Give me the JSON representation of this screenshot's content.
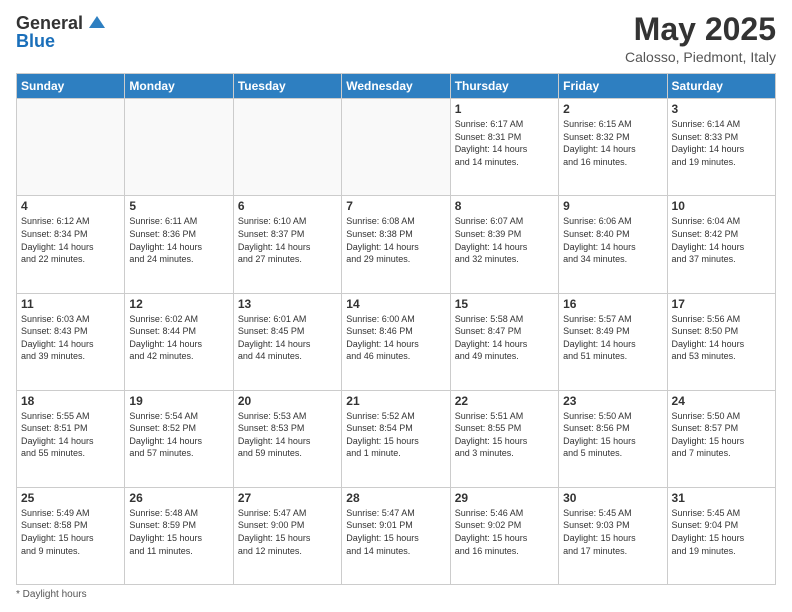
{
  "header": {
    "logo_general": "General",
    "logo_blue": "Blue",
    "month_title": "May 2025",
    "subtitle": "Calosso, Piedmont, Italy"
  },
  "weekdays": [
    "Sunday",
    "Monday",
    "Tuesday",
    "Wednesday",
    "Thursday",
    "Friday",
    "Saturday"
  ],
  "weeks": [
    [
      {
        "day": "",
        "info": ""
      },
      {
        "day": "",
        "info": ""
      },
      {
        "day": "",
        "info": ""
      },
      {
        "day": "",
        "info": ""
      },
      {
        "day": "1",
        "info": "Sunrise: 6:17 AM\nSunset: 8:31 PM\nDaylight: 14 hours\nand 14 minutes."
      },
      {
        "day": "2",
        "info": "Sunrise: 6:15 AM\nSunset: 8:32 PM\nDaylight: 14 hours\nand 16 minutes."
      },
      {
        "day": "3",
        "info": "Sunrise: 6:14 AM\nSunset: 8:33 PM\nDaylight: 14 hours\nand 19 minutes."
      }
    ],
    [
      {
        "day": "4",
        "info": "Sunrise: 6:12 AM\nSunset: 8:34 PM\nDaylight: 14 hours\nand 22 minutes."
      },
      {
        "day": "5",
        "info": "Sunrise: 6:11 AM\nSunset: 8:36 PM\nDaylight: 14 hours\nand 24 minutes."
      },
      {
        "day": "6",
        "info": "Sunrise: 6:10 AM\nSunset: 8:37 PM\nDaylight: 14 hours\nand 27 minutes."
      },
      {
        "day": "7",
        "info": "Sunrise: 6:08 AM\nSunset: 8:38 PM\nDaylight: 14 hours\nand 29 minutes."
      },
      {
        "day": "8",
        "info": "Sunrise: 6:07 AM\nSunset: 8:39 PM\nDaylight: 14 hours\nand 32 minutes."
      },
      {
        "day": "9",
        "info": "Sunrise: 6:06 AM\nSunset: 8:40 PM\nDaylight: 14 hours\nand 34 minutes."
      },
      {
        "day": "10",
        "info": "Sunrise: 6:04 AM\nSunset: 8:42 PM\nDaylight: 14 hours\nand 37 minutes."
      }
    ],
    [
      {
        "day": "11",
        "info": "Sunrise: 6:03 AM\nSunset: 8:43 PM\nDaylight: 14 hours\nand 39 minutes."
      },
      {
        "day": "12",
        "info": "Sunrise: 6:02 AM\nSunset: 8:44 PM\nDaylight: 14 hours\nand 42 minutes."
      },
      {
        "day": "13",
        "info": "Sunrise: 6:01 AM\nSunset: 8:45 PM\nDaylight: 14 hours\nand 44 minutes."
      },
      {
        "day": "14",
        "info": "Sunrise: 6:00 AM\nSunset: 8:46 PM\nDaylight: 14 hours\nand 46 minutes."
      },
      {
        "day": "15",
        "info": "Sunrise: 5:58 AM\nSunset: 8:47 PM\nDaylight: 14 hours\nand 49 minutes."
      },
      {
        "day": "16",
        "info": "Sunrise: 5:57 AM\nSunset: 8:49 PM\nDaylight: 14 hours\nand 51 minutes."
      },
      {
        "day": "17",
        "info": "Sunrise: 5:56 AM\nSunset: 8:50 PM\nDaylight: 14 hours\nand 53 minutes."
      }
    ],
    [
      {
        "day": "18",
        "info": "Sunrise: 5:55 AM\nSunset: 8:51 PM\nDaylight: 14 hours\nand 55 minutes."
      },
      {
        "day": "19",
        "info": "Sunrise: 5:54 AM\nSunset: 8:52 PM\nDaylight: 14 hours\nand 57 minutes."
      },
      {
        "day": "20",
        "info": "Sunrise: 5:53 AM\nSunset: 8:53 PM\nDaylight: 14 hours\nand 59 minutes."
      },
      {
        "day": "21",
        "info": "Sunrise: 5:52 AM\nSunset: 8:54 PM\nDaylight: 15 hours\nand 1 minute."
      },
      {
        "day": "22",
        "info": "Sunrise: 5:51 AM\nSunset: 8:55 PM\nDaylight: 15 hours\nand 3 minutes."
      },
      {
        "day": "23",
        "info": "Sunrise: 5:50 AM\nSunset: 8:56 PM\nDaylight: 15 hours\nand 5 minutes."
      },
      {
        "day": "24",
        "info": "Sunrise: 5:50 AM\nSunset: 8:57 PM\nDaylight: 15 hours\nand 7 minutes."
      }
    ],
    [
      {
        "day": "25",
        "info": "Sunrise: 5:49 AM\nSunset: 8:58 PM\nDaylight: 15 hours\nand 9 minutes."
      },
      {
        "day": "26",
        "info": "Sunrise: 5:48 AM\nSunset: 8:59 PM\nDaylight: 15 hours\nand 11 minutes."
      },
      {
        "day": "27",
        "info": "Sunrise: 5:47 AM\nSunset: 9:00 PM\nDaylight: 15 hours\nand 12 minutes."
      },
      {
        "day": "28",
        "info": "Sunrise: 5:47 AM\nSunset: 9:01 PM\nDaylight: 15 hours\nand 14 minutes."
      },
      {
        "day": "29",
        "info": "Sunrise: 5:46 AM\nSunset: 9:02 PM\nDaylight: 15 hours\nand 16 minutes."
      },
      {
        "day": "30",
        "info": "Sunrise: 5:45 AM\nSunset: 9:03 PM\nDaylight: 15 hours\nand 17 minutes."
      },
      {
        "day": "31",
        "info": "Sunrise: 5:45 AM\nSunset: 9:04 PM\nDaylight: 15 hours\nand 19 minutes."
      }
    ]
  ],
  "footer": "Daylight hours"
}
